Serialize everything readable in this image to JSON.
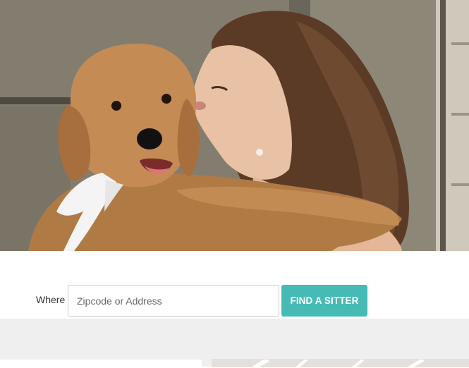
{
  "hero": {
    "image": "woman-kissing-puppy-photo"
  },
  "search": {
    "where_label": "Where",
    "placeholder": "Zipcode or Address",
    "value": "",
    "button_label": "FIND A SITTER"
  },
  "colors": {
    "accent": "#46bbb5",
    "map_background": "#efefef"
  }
}
